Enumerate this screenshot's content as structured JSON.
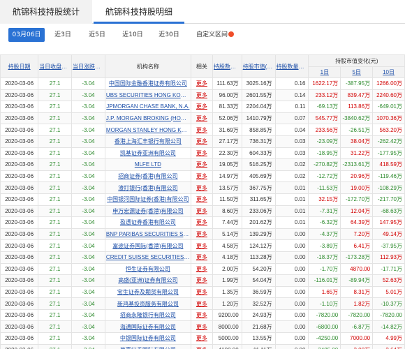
{
  "tabs": [
    "航锦科技持股统计",
    "航锦科技持股明细"
  ],
  "subtabs": [
    "03月06日",
    "近3日",
    "近5日",
    "近10日",
    "近30日",
    "自定义区间"
  ],
  "columns": {
    "date": "持股日期",
    "close": "当日收盘价(元)",
    "change": "当日涨跌幅(%)",
    "institution": "机构名称",
    "related": "相关",
    "shares": "持股数量(股)",
    "value": "持股市值(元)",
    "ratio": "持股数量占A股百分比(%)",
    "value_change": "持股市值变化(元)",
    "d1": "1日",
    "d5": "5日",
    "d10": "10日"
  },
  "rows": [
    {
      "date": "2020-03-06",
      "close": "27.1",
      "chg": "-3.04",
      "name": "中国国际金融香港证券有限公司",
      "more": "更多",
      "shares": "111.63万",
      "value": "3025.16万",
      "ratio": "0.16",
      "d1": "1622.17万",
      "d5": "-387.95万",
      "d10": "1266.00万"
    },
    {
      "date": "2020-03-06",
      "close": "27.1",
      "chg": "-3.04",
      "name": "UBS SECURITIES HONG KONG LIMITED",
      "more": "更多",
      "shares": "96.00万",
      "value": "2601.55万",
      "ratio": "0.14",
      "d1": "233.12万",
      "d5": "839.47万",
      "d10": "2240.60万"
    },
    {
      "date": "2020-03-06",
      "close": "27.1",
      "chg": "-3.04",
      "name": "JPMORGAN CHASE BANK, N.A.",
      "more": "更多",
      "shares": "81.33万",
      "value": "2204.04万",
      "ratio": "0.11",
      "d1": "-69.13万",
      "d5": "113.86万",
      "d10": "-649.01万"
    },
    {
      "date": "2020-03-06",
      "close": "27.1",
      "chg": "-3.04",
      "name": "J.P. MORGAN BROKING (HONG KONG)",
      "more": "更多",
      "shares": "52.06万",
      "value": "1410.79万",
      "ratio": "0.07",
      "d1": "545.77万",
      "d5": "-3840.62万",
      "d10": "1070.36万"
    },
    {
      "date": "2020-03-06",
      "close": "27.1",
      "chg": "-3.04",
      "name": "MORGAN STANLEY HONG KONG SECURITIES",
      "more": "更多",
      "shares": "31.69万",
      "value": "858.85万",
      "ratio": "0.04",
      "d1": "233.56万",
      "d5": "-26.51万",
      "d10": "563.20万"
    },
    {
      "date": "2020-03-06",
      "close": "27.1",
      "chg": "-3.04",
      "name": "香港上海汇丰银行有限公司",
      "more": "更多",
      "shares": "27.17万",
      "value": "736.31万",
      "ratio": "0.03",
      "d1": "-23.09万",
      "d5": "38.04万",
      "d10": "-262.42万"
    },
    {
      "date": "2020-03-06",
      "close": "27.1",
      "chg": "-3.04",
      "name": "凯基证券亚洲有限公司",
      "more": "更多",
      "shares": "22.30万",
      "value": "604.33万",
      "ratio": "0.03",
      "d1": "-18.95万",
      "d5": "31.22万",
      "d10": "-177.95万"
    },
    {
      "date": "2020-03-06",
      "close": "27.1",
      "chg": "-3.04",
      "name": "MLFE LTD",
      "more": "更多",
      "shares": "19.05万",
      "value": "516.25万",
      "ratio": "0.02",
      "d1": "-270.82万",
      "d5": "-2313.61万",
      "d10": "418.59万"
    },
    {
      "date": "2020-03-06",
      "close": "27.1",
      "chg": "-3.04",
      "name": "招商证券(香港)有限公司",
      "more": "更多",
      "shares": "14.97万",
      "value": "405.69万",
      "ratio": "0.02",
      "d1": "-12.72万",
      "d5": "20.96万",
      "d10": "-119.46万"
    },
    {
      "date": "2020-03-06",
      "close": "27.1",
      "chg": "-3.04",
      "name": "渣打银行(香港)有限公司",
      "more": "更多",
      "shares": "13.57万",
      "value": "367.75万",
      "ratio": "0.01",
      "d1": "-11.53万",
      "d5": "19.00万",
      "d10": "-108.29万"
    },
    {
      "date": "2020-03-06",
      "close": "27.1",
      "chg": "-3.04",
      "name": "中国银河国际证券(香港)有限公司",
      "more": "更多",
      "shares": "11.50万",
      "value": "311.65万",
      "ratio": "0.01",
      "d1": "32.15万",
      "d5": "-172.70万",
      "d10": "-217.70万"
    },
    {
      "date": "2020-03-06",
      "close": "27.1",
      "chg": "-3.04",
      "name": "申万宏源证券(香港)有限公司",
      "more": "更多",
      "shares": "8.60万",
      "value": "233.06万",
      "ratio": "0.01",
      "d1": "-7.31万",
      "d5": "12.04万",
      "d10": "-68.63万"
    },
    {
      "date": "2020-03-06",
      "close": "27.1",
      "chg": "-3.04",
      "name": "盈透证券香港有限公司",
      "more": "更多",
      "shares": "7.44万",
      "value": "201.62万",
      "ratio": "0.01",
      "d1": "-6.32万",
      "d5": "64.39万",
      "d10": "147.95万"
    },
    {
      "date": "2020-03-06",
      "close": "27.1",
      "chg": "-3.04",
      "name": "BNP PARIBAS SECURITIES SERVICES",
      "more": "更多",
      "shares": "5.14万",
      "value": "139.29万",
      "ratio": "0.00",
      "d1": "-4.37万",
      "d5": "7.20万",
      "d10": "49.14万"
    },
    {
      "date": "2020-03-06",
      "close": "27.1",
      "chg": "-3.04",
      "name": "富途证券国际(香港)有限公司",
      "more": "更多",
      "shares": "4.58万",
      "value": "124.12万",
      "ratio": "0.00",
      "d1": "-3.89万",
      "d5": "6.41万",
      "d10": "-37.95万"
    },
    {
      "date": "2020-03-06",
      "close": "27.1",
      "chg": "-3.04",
      "name": "CREDIT SUISSE SECURITIES (HONG KONG)",
      "more": "更多",
      "shares": "4.18万",
      "value": "113.28万",
      "ratio": "0.00",
      "d1": "-18.37万",
      "d5": "-173.28万",
      "d10": "112.93万"
    },
    {
      "date": "2020-03-06",
      "close": "27.1",
      "chg": "-3.04",
      "name": "恒生证券有限公司",
      "more": "更多",
      "shares": "2.00万",
      "value": "54.20万",
      "ratio": "0.00",
      "d1": "-1.70万",
      "d5": "4870.00",
      "d10": "-17.71万"
    },
    {
      "date": "2020-03-06",
      "close": "27.1",
      "chg": "-3.04",
      "name": "高盛(亚洲)证券有限公司",
      "more": "更多",
      "shares": "1.99万",
      "value": "54.04万",
      "ratio": "0.00",
      "d1": "-116.01万",
      "d5": "-89.94万",
      "d10": "52.63万"
    },
    {
      "date": "2020-03-06",
      "close": "27.1",
      "chg": "-3.04",
      "name": "宝生证券及期货有限公司",
      "more": "更多",
      "shares": "1.35万",
      "value": "36.59万",
      "ratio": "0.00",
      "d1": "1.65万",
      "d5": "8.31万",
      "d10": "5.01万"
    },
    {
      "date": "2020-03-06",
      "close": "27.1",
      "chg": "-3.04",
      "name": "新鸿基投资服务有限公司",
      "more": "更多",
      "shares": "1.20万",
      "value": "32.52万",
      "ratio": "0.00",
      "d1": "-1.10万",
      "d5": "1.82万",
      "d10": "-10.37万"
    },
    {
      "date": "2020-03-06",
      "close": "27.1",
      "chg": "-3.04",
      "name": "招商永隆银行有限公司",
      "more": "更多",
      "shares": "9200.00",
      "value": "24.93万",
      "ratio": "0.00",
      "d1": "-7820.00",
      "d5": "-7820.00",
      "d10": "-7820.00"
    },
    {
      "date": "2020-03-06",
      "close": "27.1",
      "chg": "-3.04",
      "name": "海通国际证券有限公司",
      "more": "更多",
      "shares": "8000.00",
      "value": "21.68万",
      "ratio": "0.00",
      "d1": "-6800.00",
      "d5": "-6.87万",
      "d10": "-14.82万"
    },
    {
      "date": "2020-03-06",
      "close": "27.1",
      "chg": "-3.04",
      "name": "中银国际证券有限公司",
      "more": "更多",
      "shares": "5000.00",
      "value": "13.55万",
      "ratio": "0.00",
      "d1": "-4250.00",
      "d5": "7000.00",
      "d10": "4.99万"
    },
    {
      "date": "2020-03-06",
      "close": "27.1",
      "chg": "-3.04",
      "name": "尊嘉证券国际有限公司",
      "more": "更多",
      "shares": "4100.00",
      "value": "11.11万",
      "ratio": "0.00",
      "d1": "-3485.00",
      "d5": "3.00万",
      "d10": "2.64万"
    }
  ],
  "colors": {
    "accent": "#2a72d4",
    "up": "#d20000",
    "down": "#2e8b2e",
    "link": "#1d4fa8"
  }
}
